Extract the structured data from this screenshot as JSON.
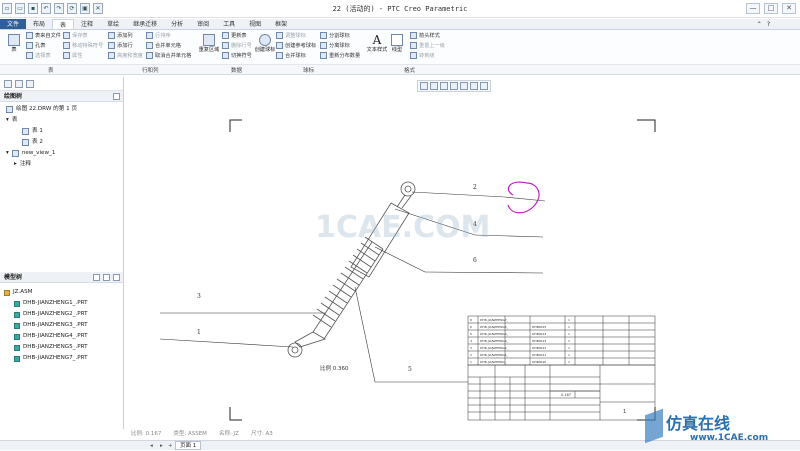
{
  "window": {
    "title": "22 (活动的) - PTC Creo Parametric",
    "controls": [
      "—",
      "□",
      "✕"
    ]
  },
  "tabs": [
    "文件",
    "布局",
    "表",
    "注释",
    "草绘",
    "继承迁移",
    "分析",
    "审阅",
    "工具",
    "视图",
    "框架"
  ],
  "active_tab": "表",
  "ribbon": {
    "table_big": "表",
    "col1": [
      "表来自文件",
      "孔表",
      "选择表"
    ],
    "col2": [
      "保存表",
      "移动特殊符号",
      "属性"
    ],
    "col3": [
      "添加列",
      "添加行",
      "高度和宽度"
    ],
    "col4": [
      "行排序",
      "合并单元格",
      "取消合并单元格"
    ],
    "update_big": "更新表",
    "repeat_big": "重复区域",
    "col5": [
      "更新表",
      "删除行号",
      "切换符号"
    ],
    "create_balloon": "创建球标",
    "col6": [
      "调整球标",
      "创建参考球标",
      "合并球标"
    ],
    "col7": [
      "分割球标",
      "分离球标",
      "重新分布数量"
    ],
    "text_style": "文本样式",
    "line_style": "线型",
    "col8": [
      "箭头样式",
      "重置上一级",
      "转到级"
    ],
    "groups": [
      "表",
      "行和列",
      "数据",
      "球标",
      "格式"
    ]
  },
  "drawing_tree": {
    "title": "绘图树",
    "nodes": [
      "绘图 22.DRW 的第 1 页",
      "表",
      "表 1",
      "表 2",
      "new_view_1",
      "注释"
    ]
  },
  "model_tree": {
    "title": "模型树",
    "root": "JZ.ASM",
    "parts": [
      "DHB-JIANZHENG1_.PRT",
      "DHB-JIANZHENG2_.PRT",
      "DHB-JIANZHENG3_.PRT",
      "DHB-JIANZHENG4_.PRT",
      "DHB-JIANZHENG5_.PRT",
      "DHB-JIANZHENG7_.PRT"
    ]
  },
  "canvas": {
    "balloons": [
      "2",
      "4",
      "6",
      "3",
      "1",
      "5"
    ],
    "scale_text": "比例 0.360",
    "bom_rows": [
      [
        "8",
        "DHB-JIANZHENG7_",
        "",
        "1"
      ],
      [
        "6",
        "DHB-JIANZHENG5_",
        "DHB0025",
        "1"
      ],
      [
        "5",
        "DHB-JIANZHENG4_",
        "DHB0024",
        "1"
      ],
      [
        "4",
        "DHB-JIANZHENG3_",
        "DHB0023",
        "1"
      ],
      [
        "3",
        "DHB-JIANZHENG2_",
        "DHB0022",
        "1"
      ],
      [
        "2",
        "DHB-JIANZHENG1_",
        "DHB0021",
        "1"
      ],
      [
        "1",
        "DHB-JIANZHENG_",
        "DHB0020",
        "1"
      ]
    ],
    "title_scale": "0.167",
    "title_sheet": "1"
  },
  "status": [
    "比例: 0.167",
    "类型: ASSEM",
    "名称: JZ",
    "尺寸: A3"
  ],
  "sheet_tab": "页面 1",
  "watermark": {
    "center": "1CAE.COM",
    "brand": "仿真在线",
    "site": "www.1CAE.com"
  },
  "colors": {
    "accent": "#2f5f98",
    "sketch_magenta": "#c020c0",
    "part_icon": "#3ea8a0"
  }
}
